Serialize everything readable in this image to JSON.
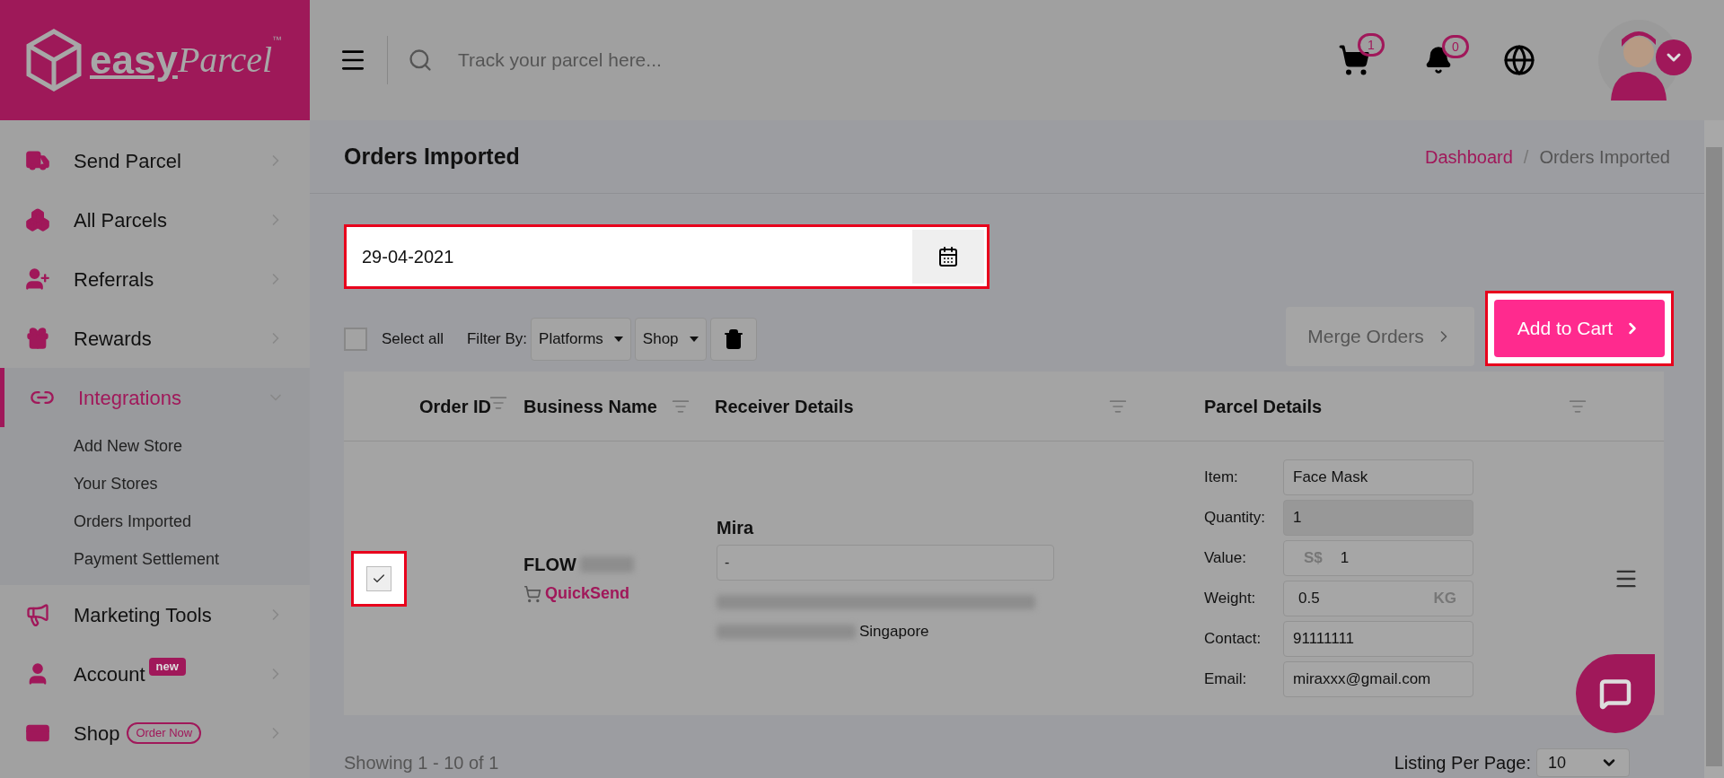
{
  "logo": {
    "wordmark": "easy",
    "script": "Parcel",
    "tm": "™"
  },
  "header": {
    "search_placeholder": "Track your parcel here...",
    "cart_count": "1",
    "notification_count": "0"
  },
  "sidebar": {
    "items": [
      {
        "label": "Send Parcel",
        "selected": false,
        "expanded": false
      },
      {
        "label": "All Parcels",
        "selected": false,
        "expanded": false
      },
      {
        "label": "Referrals",
        "selected": false,
        "expanded": false
      },
      {
        "label": "Rewards",
        "selected": false,
        "expanded": false
      },
      {
        "label": "Integrations",
        "selected": true,
        "expanded": true,
        "children": [
          {
            "label": "Add New Store"
          },
          {
            "label": "Your Stores"
          },
          {
            "label": "Orders Imported"
          },
          {
            "label": "Payment Settlement"
          }
        ]
      },
      {
        "label": "Marketing Tools",
        "selected": false,
        "expanded": false
      },
      {
        "label": "Account",
        "selected": false,
        "expanded": false,
        "badge": {
          "text": "new",
          "kind": "filled"
        }
      },
      {
        "label": "Shop",
        "selected": false,
        "expanded": false,
        "badge": {
          "text": "Order Now",
          "kind": "outline"
        }
      }
    ]
  },
  "page": {
    "title": "Orders Imported",
    "breadcrumb_separator": "/",
    "breadcrumb": [
      {
        "label": "Dashboard",
        "link": true
      },
      {
        "label": "Orders Imported",
        "link": false
      }
    ]
  },
  "date_field": {
    "value": "29-04-2021",
    "highlighted": true
  },
  "toolbar": {
    "select_all": {
      "label": "Select all",
      "checked": false
    },
    "filter_label": "Filter By:",
    "filters": [
      "Platforms",
      "Shop"
    ],
    "merge_button": {
      "label": "Merge Orders",
      "highlighted": false
    },
    "add_button": {
      "label": "Add to Cart",
      "highlighted": true
    }
  },
  "table": {
    "columns": [
      {
        "label": "Order ID"
      },
      {
        "label": "Business Name"
      },
      {
        "label": "Receiver Details"
      },
      {
        "label": "Parcel Details"
      }
    ],
    "rows": [
      {
        "checked": true,
        "highlighted": true,
        "business": "FLOW",
        "platform": "QuickSend",
        "receiver_name": "Mira",
        "address_line": "-",
        "address_end": "Singapore",
        "parcel": [
          {
            "label": "Item:",
            "value": "Face Mask",
            "disabled": false
          },
          {
            "label": "Quantity:",
            "value": "1",
            "disabled": true
          },
          {
            "label": "Value:",
            "prefix": "S$",
            "value": "1",
            "disabled": false
          },
          {
            "label": "Weight:",
            "value": "0.5",
            "suffix": "KG",
            "disabled": false
          },
          {
            "label": "Contact:",
            "value": "91111111",
            "disabled": false
          },
          {
            "label": "Email:",
            "value": "miraxxx@gmail.com",
            "disabled": false
          }
        ]
      }
    ]
  },
  "footer": {
    "showing": "Showing 1 - 10 of 1",
    "per_page_label": "Listing Per Page:",
    "per_page": "10"
  }
}
